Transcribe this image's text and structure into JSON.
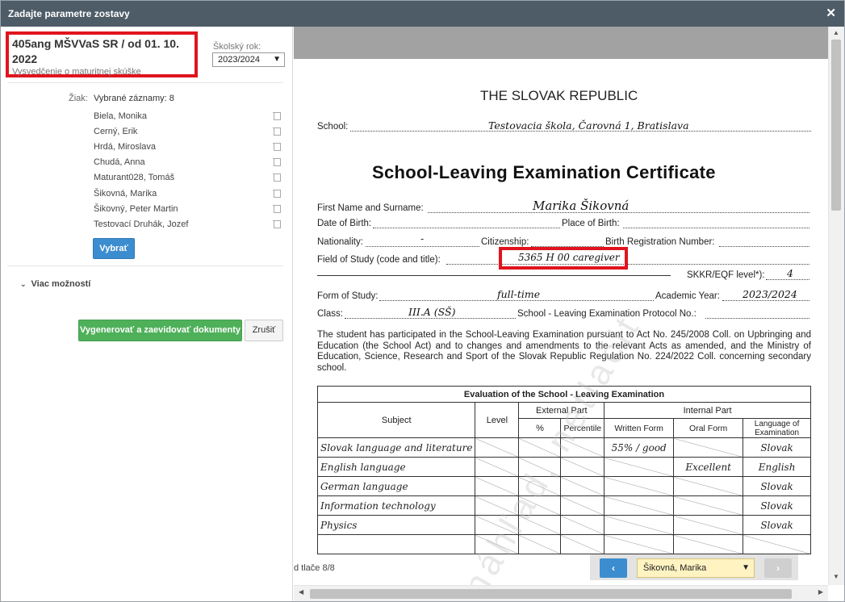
{
  "dialog": {
    "title": "Zadajte parametre zostavy"
  },
  "report": {
    "title": "405ang MŠVVaS SR / od 01. 10. 2022",
    "subtitle": "Vysvedčenie o maturitnej skúške",
    "year_label": "Školský rok:",
    "year_value": "2023/2024"
  },
  "students": {
    "label": "Žiak:",
    "count_text": "Vybrané záznamy: 8",
    "items": [
      "Biela, Monika",
      "Cerný, Erik",
      "Hrdá, Miroslava",
      "Chudá, Anna",
      "Maturant028, Tomáš",
      "Šikovná, Marika",
      "Šikovný, Peter Martin",
      "Testovací Druhák, Jozef"
    ],
    "select_button": "Vybrať"
  },
  "more_options": "Viac možností",
  "actions": {
    "generate": "Vygenerovať a zaevidovať dokumenty",
    "cancel": "Zrušiť"
  },
  "certificate": {
    "republic": "THE SLOVAK REPUBLIC",
    "school_label": "School:",
    "school_value": "Testovacia škola, Čarovná 1, Bratislava",
    "title": "School-Leaving Examination Certificate",
    "name_label": "First Name and Surname:",
    "name_value": "Marika Šikovná",
    "dob_label": "Date of Birth:",
    "pob_label": "Place of Birth:",
    "nationality_label": "Nationality:",
    "nationality_value": "-",
    "citizenship_label": "Citizenship:",
    "birth_reg_label": "Birth Registration Number:",
    "field_label": "Field of Study (code and title):",
    "field_value": "5365 H 00 caregiver",
    "skkr_label": "SKKR/EQF level*):",
    "skkr_value": "4",
    "form_label": "Form of Study:",
    "form_value": "full-time",
    "academic_year_label": "Academic Year:",
    "academic_year_value": "2023/2024",
    "class_label": "Class:",
    "class_value": "III.A (SŠ)",
    "protocol_label": "School - Leaving Examination Protocol No.:",
    "paragraph": "The student has participated in the School-Leaving Examination pursuant to Act No. 245/2008 Coll. on Upbringing and Education (the School Act) and to changes and amendments to the relevant Acts as amended, and the Ministry of Education, Science, Research and Sport of the Slovak Republic Regulation No. 224/2022 Coll. concerning secondary school.",
    "watermark": "náhľad, netlačiť",
    "table": {
      "caption": "Evaluation of the School - Leaving Examination",
      "subject": "Subject",
      "level": "Level",
      "external": "External Part",
      "internal": "Internal Part",
      "pct": "%",
      "percentile": "Percentile",
      "written": "Written Form",
      "oral": "Oral Form",
      "language": "Language of Examination",
      "rows": [
        {
          "subject": "Slovak language and literature",
          "written": "55% / good",
          "oral": "",
          "language": "Slovak"
        },
        {
          "subject": "English language",
          "written": "",
          "oral": "Excellent",
          "language": "English"
        },
        {
          "subject": "German language",
          "written": "",
          "oral": "",
          "language": "Slovak"
        },
        {
          "subject": "Information technology",
          "written": "",
          "oral": "",
          "language": "Slovak"
        },
        {
          "subject": "Physics",
          "written": "",
          "oral": "",
          "language": "Slovak"
        }
      ]
    }
  },
  "pager": {
    "text": "d tlače 8/8",
    "prev": "‹",
    "next": "›",
    "selected": "Šikovná, Marika"
  },
  "colors": {
    "titlebar": "#4e5c67",
    "primary": "#3c8dcf",
    "success": "#4fb05a",
    "highlight": "#e0141e"
  }
}
